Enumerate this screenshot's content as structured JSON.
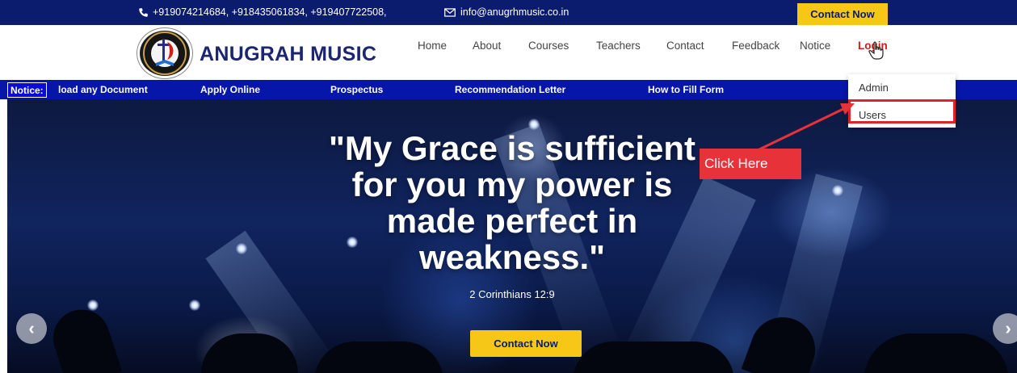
{
  "topbar": {
    "phones": "+919074214684, +918435061834, +919407722508,",
    "email": "info@anugrhmusic.co.in",
    "cta_label": "Contact Now",
    "phone_icon": "phone-icon",
    "mail_icon": "mail-icon"
  },
  "header": {
    "brand": "ANUGRAH MUSIC",
    "nav": [
      "Home",
      "About",
      "Courses",
      "Teachers",
      "Contact",
      "Feedback",
      "Notice",
      "Login"
    ]
  },
  "login_dropdown": {
    "items": [
      "Admin",
      "Users"
    ]
  },
  "notice_bar": {
    "badge": "Notice:",
    "items": [
      "load any Document",
      "Apply Online",
      "Prospectus",
      "Recommendation Letter",
      "How to Fill Form"
    ]
  },
  "hero": {
    "quote_lines": [
      "\"My Grace is sufficient",
      "for you my power is",
      "made perfect in",
      "weakness.\""
    ],
    "reference": "2 Corinthians 12:9",
    "cta_label": "Contact Now"
  },
  "annotation": {
    "callout": "Click Here",
    "color": "#e8323a"
  },
  "colors": {
    "topbar": "#0b1b6e",
    "accent": "#f7c717",
    "notice": "#0616a8",
    "login": "#d21c1c"
  }
}
